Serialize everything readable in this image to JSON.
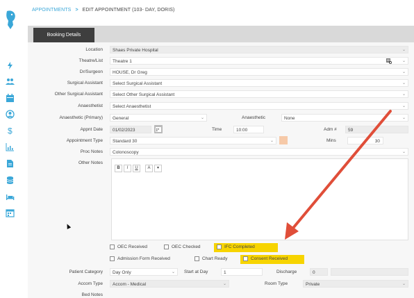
{
  "breadcrumb": {
    "parent": "APPOINTMENTS",
    "separator": ">",
    "current": "EDIT APPOINTMENT (103- DAY, DORIS)"
  },
  "tabs": [
    {
      "label": "Booking Details"
    }
  ],
  "colors": {
    "accent": "#3aa7d8",
    "highlight": "#f7d400",
    "arrow": "#e04e39",
    "tab": "#3e3e3e"
  },
  "form": {
    "location": {
      "label": "Location",
      "value": "Shaes Private Hospital"
    },
    "theatre": {
      "label": "Theatre/List",
      "value": "Theatre 1"
    },
    "surgeon": {
      "label": "Dr/Surgeon",
      "value": "HOUSE, Dr Greg"
    },
    "assistant": {
      "label": "Surgical Assistant",
      "value": "Select Surgical Assistant"
    },
    "other_assistant": {
      "label": "Other Surgical Assistant",
      "value": "Select Other Surgical Assistant"
    },
    "anaesthetist": {
      "label": "Anaesthetist",
      "value": "Select Anaesthetist"
    },
    "anaesthetic_primary": {
      "label": "Anaesthetic (Primary)",
      "value": "General"
    },
    "anaesthetic": {
      "label": "Anaesthetic",
      "value": "None"
    },
    "appt_date": {
      "label": "Appnt Date",
      "value": "01/02/2023"
    },
    "time": {
      "label": "Time",
      "value": "10:00"
    },
    "adm": {
      "label": "Adm #",
      "value": "59"
    },
    "appt_type": {
      "label": "Appointment Type",
      "value": "Standard 30"
    },
    "mins": {
      "label": "Mins",
      "value": "30"
    },
    "proc_notes": {
      "label": "Proc Notes",
      "value": "Colonoscopy"
    },
    "other_notes": {
      "label": "Other Notes"
    },
    "editor_tools": [
      "B",
      "I",
      "U",
      "A",
      "▾"
    ],
    "checks_row1": [
      {
        "label": "OEC Received",
        "checked": false
      },
      {
        "label": "OEC Checked",
        "checked": false
      },
      {
        "label": "IFC Completed",
        "checked": false,
        "highlighted": true
      }
    ],
    "checks_row2": [
      {
        "label": "Admission Form Received",
        "checked": false
      },
      {
        "label": "Chart Ready",
        "checked": false
      },
      {
        "label": "Consent Received",
        "checked": false,
        "highlighted": true
      }
    ],
    "patient_category": {
      "label": "Patient Category",
      "value": "Day Only"
    },
    "start_at_day": {
      "label": "Start at Day",
      "value": "1"
    },
    "discharge": {
      "label": "Discharge",
      "value": "0"
    },
    "accom_type": {
      "label": "Accom Type",
      "value": "Accom - Medical"
    },
    "room_type": {
      "label": "Room Type",
      "value": "Private"
    },
    "bed_notes": {
      "label": "Bed Notes"
    }
  },
  "icons": [
    "logo-icon",
    "bolt-icon",
    "users-icon",
    "calendar-icon",
    "user-circle-icon",
    "dollar-icon",
    "chart-icon",
    "document-icon",
    "database-icon",
    "bed-icon",
    "calendar-grid-icon",
    "calendar-picker-icon",
    "list-lookup-icon",
    "chevron-down-icon",
    "mouse-cursor-icon",
    "annotation-arrow-icon"
  ]
}
